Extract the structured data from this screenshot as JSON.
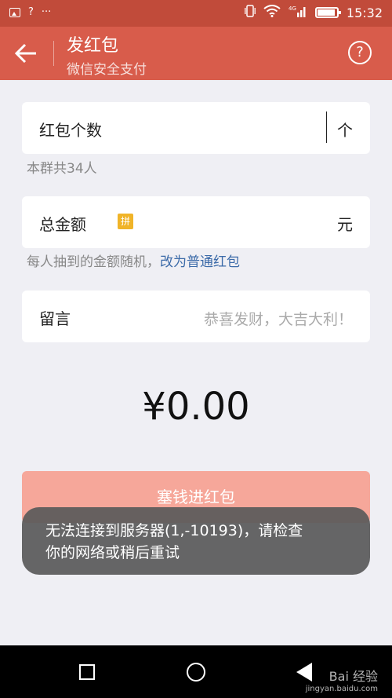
{
  "status_bar": {
    "left_icons": [
      "image-icon",
      "question-icon",
      "more-icon"
    ],
    "right_icons": [
      "vibrate-icon",
      "wifi-icon",
      "signal-4g-icon",
      "battery-icon"
    ],
    "question_glyph": "?",
    "more_glyph": "···",
    "time": "15:32"
  },
  "header": {
    "title": "发红包",
    "subtitle": "微信安全支付",
    "help_glyph": "?"
  },
  "count_field": {
    "label": "红包个数",
    "unit": "个",
    "hint": "本群共34人"
  },
  "amount_field": {
    "label": "总金额",
    "badge": "拼",
    "unit": "元",
    "hint": "每人抽到的金额随机，",
    "hint_link": "改为普通红包"
  },
  "message_field": {
    "label": "留言",
    "placeholder": "恭喜发财，大吉大利！"
  },
  "total": "¥0.00",
  "submit_button": "塞钱进红包",
  "toast": {
    "line1": "无法连接到服务器(1,-10193)，请检查",
    "line2": "你的网络或稍后重试"
  },
  "watermark": {
    "main": "Bai 经验",
    "url": "jingyan.baidu.com"
  },
  "colors": {
    "status_bar": "#c14b3a",
    "title_bar": "#d85c4b",
    "submit_disabled": "#f6a79a",
    "link": "#3b6aa8",
    "badge": "#f0b429"
  }
}
